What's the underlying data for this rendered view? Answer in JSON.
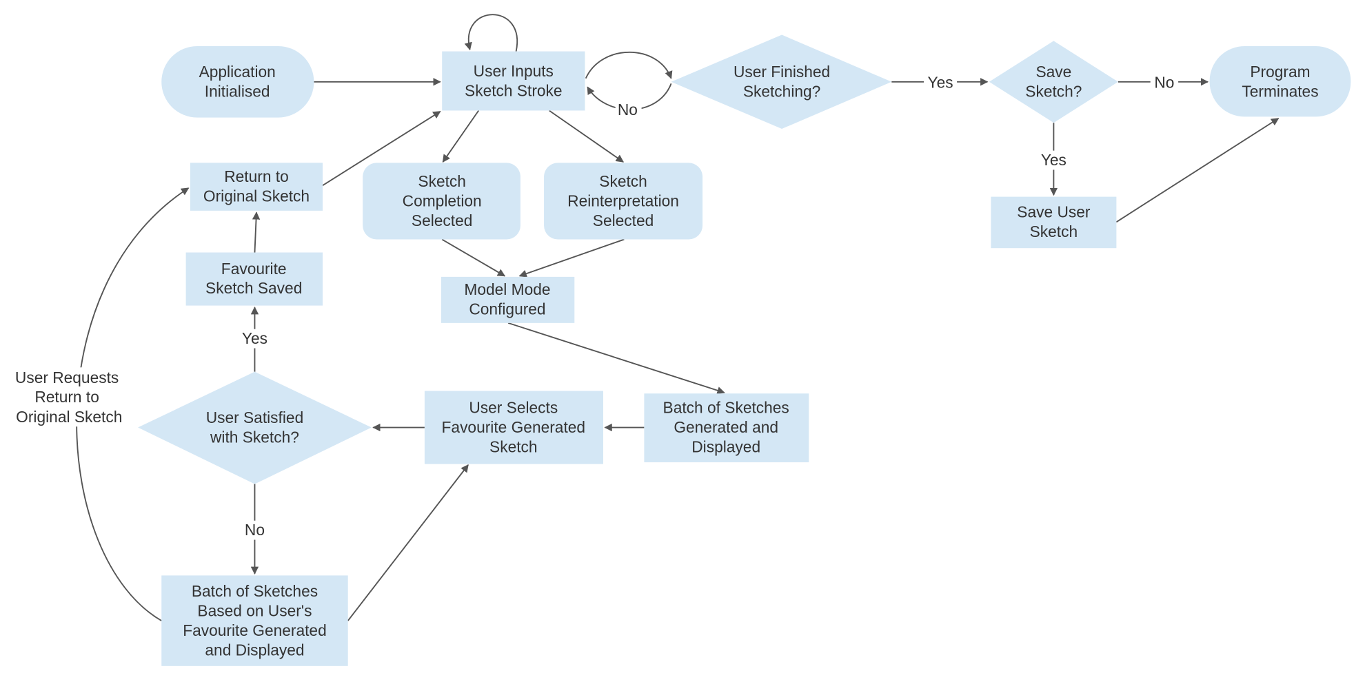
{
  "colors": {
    "node_fill": "#d4e7f5",
    "edge": "#555555",
    "text": "#333333"
  },
  "nodes": {
    "app_init": [
      "Application",
      "Initialised"
    ],
    "user_inputs": [
      "User Inputs",
      "Sketch Stroke"
    ],
    "finished": [
      "User Finished",
      "Sketching?"
    ],
    "save": [
      "Save",
      "Sketch?"
    ],
    "terminates": [
      "Program",
      "Terminates"
    ],
    "save_user": [
      "Save User",
      "Sketch"
    ],
    "return_original": [
      "Return to",
      "Original Sketch"
    ],
    "completion": [
      "Sketch",
      "Completion",
      "Selected"
    ],
    "reinterp": [
      "Sketch",
      "Reinterpretation",
      "Selected"
    ],
    "fav_saved": [
      "Favourite",
      "Sketch Saved"
    ],
    "model_mode": [
      "Model Mode",
      "Configured"
    ],
    "satisfied": [
      "User Satisfied",
      "with Sketch?"
    ],
    "user_selects": [
      "User Selects",
      "Favourite Generated",
      "Sketch"
    ],
    "batch1": [
      "Batch of Sketches",
      "Generated and",
      "Displayed"
    ],
    "batch2": [
      "Batch of Sketches",
      "Based on User's",
      "Favourite Generated",
      "and Displayed"
    ]
  },
  "edge_labels": {
    "no_loop": "No",
    "finished_yes": "Yes",
    "save_no": "No",
    "save_yes": "Yes",
    "satisfied_yes": "Yes",
    "satisfied_no": "No",
    "return_request": [
      "User Requests",
      "Return to",
      "Original Sketch"
    ]
  }
}
